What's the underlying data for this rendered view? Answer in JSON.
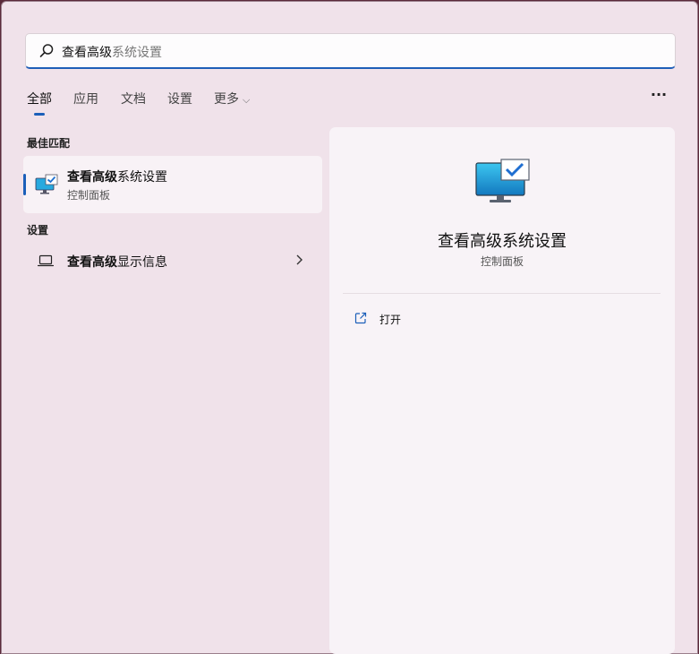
{
  "search": {
    "typed": "查看高级",
    "suggestion": "系统设置"
  },
  "tabs": [
    {
      "label": "全部"
    },
    {
      "label": "应用"
    },
    {
      "label": "文档"
    },
    {
      "label": "设置"
    },
    {
      "label": "更多"
    }
  ],
  "overflow_label": "···",
  "best_match": {
    "section_label": "最佳匹配",
    "title_bold": "查看高级",
    "title_rest": "系统设置",
    "subtitle": "控制面板"
  },
  "settings": {
    "section_label": "设置",
    "item_bold": "查看高级",
    "item_rest": "显示信息"
  },
  "detail": {
    "title": "查看高级系统设置",
    "subtitle": "控制面板",
    "action_label": "打开"
  },
  "colors": {
    "accent": "#1b5fb9",
    "background": "#f0e2ea"
  }
}
